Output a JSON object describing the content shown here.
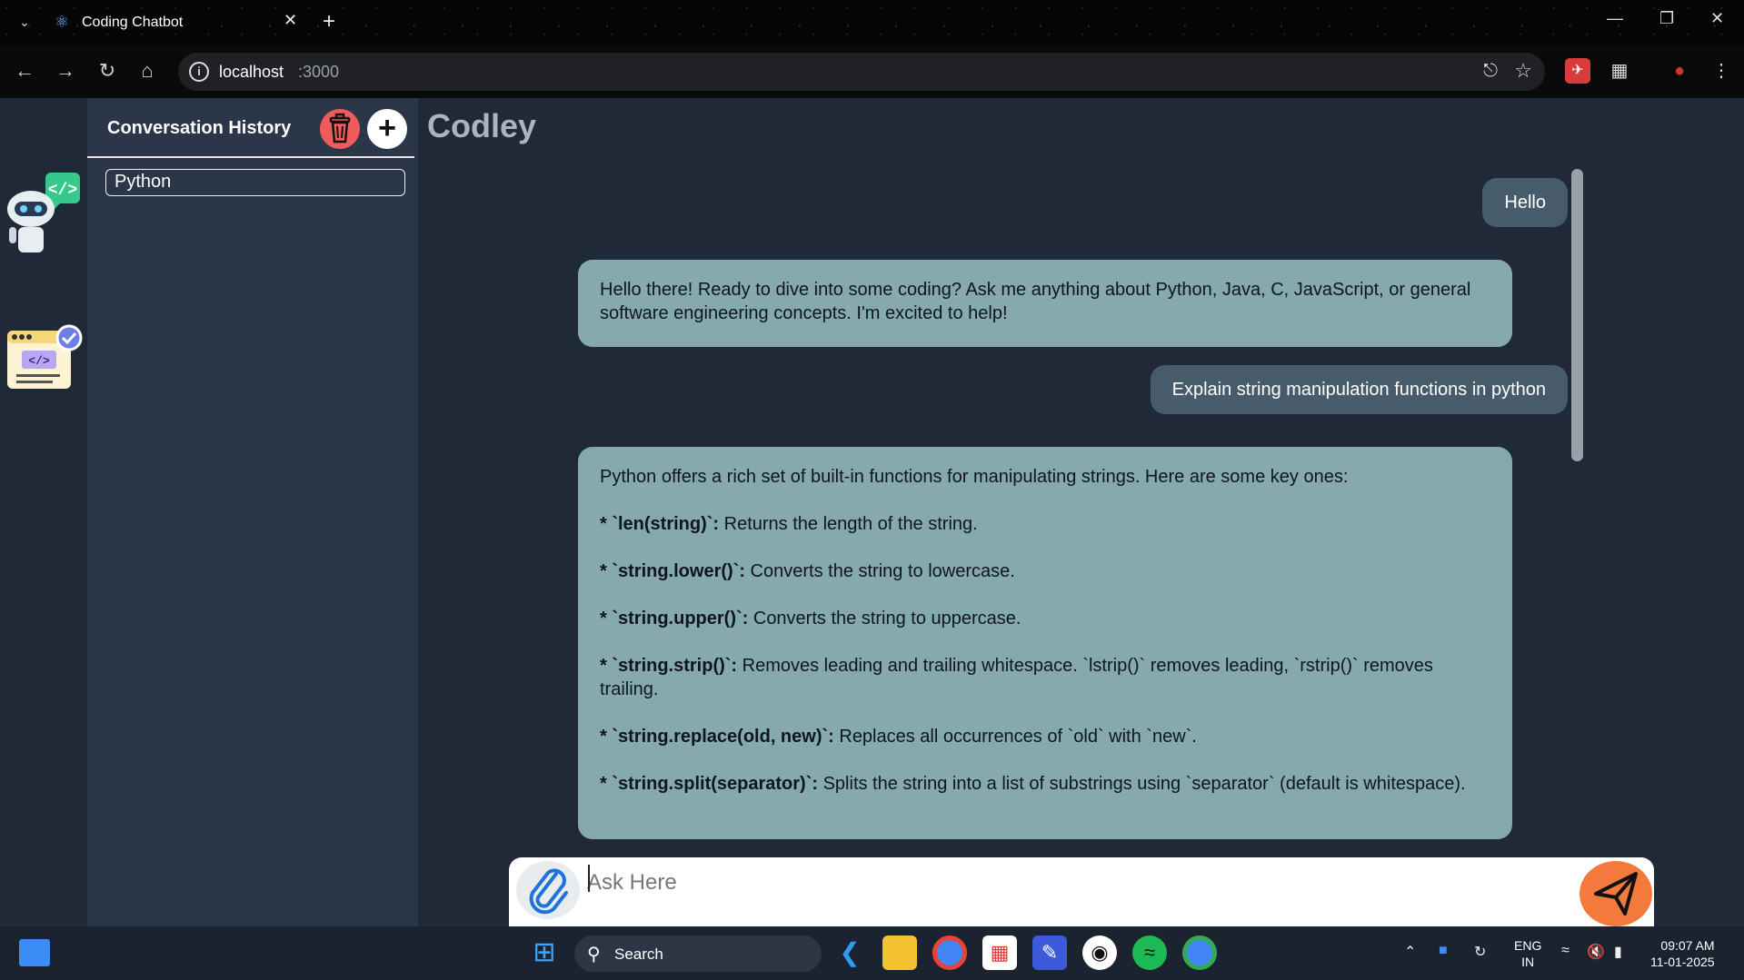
{
  "browser": {
    "tab_title": "Coding Chatbot",
    "url_host": "localhost",
    "url_port": ":3000"
  },
  "sidebar": {
    "title": "Conversation History",
    "items": [
      {
        "label": "Python"
      }
    ]
  },
  "main": {
    "app_title": "Codley",
    "messages": [
      {
        "role": "user",
        "text": "Hello"
      },
      {
        "role": "bot",
        "text": "Hello there!  Ready to dive into some coding?  Ask me anything about Python, Java, C, JavaScript, or general software engineering concepts. I'm excited to help!"
      },
      {
        "role": "user",
        "text": "Explain string manipulation functions in python"
      },
      {
        "role": "bot",
        "intro": "Python offers a rich set of built-in functions for manipulating strings. Here are some key ones:",
        "items": [
          {
            "bullet": "* `len(string)`:",
            "desc": " Returns the length of the string."
          },
          {
            "bullet": "* `string.lower()`:",
            "desc": " Converts the string to lowercase."
          },
          {
            "bullet": "* `string.upper()`:",
            "desc": " Converts the string to uppercase."
          },
          {
            "bullet": "* `string.strip()`:",
            "desc": " Removes leading and trailing whitespace.  `lstrip()` removes leading, `rstrip()` removes trailing."
          },
          {
            "bullet": "* `string.replace(old, new)`:",
            "desc": " Replaces all occurrences of `old` with `new`."
          },
          {
            "bullet": "* `string.split(separator)`:",
            "desc": " Splits the string into a list of substrings using `separator` (default is whitespace)."
          }
        ]
      }
    ],
    "input_placeholder": "Ask Here"
  },
  "taskbar": {
    "search_label": "Search",
    "lang_top": "ENG",
    "lang_bottom": "IN",
    "time": "09:07 AM",
    "date": "11-01-2025"
  },
  "colors": {
    "user_bubble": "#475c6b",
    "bot_bubble": "#86a9ab",
    "trash_button": "#f25b5b",
    "send_button": "#f37a3c"
  }
}
